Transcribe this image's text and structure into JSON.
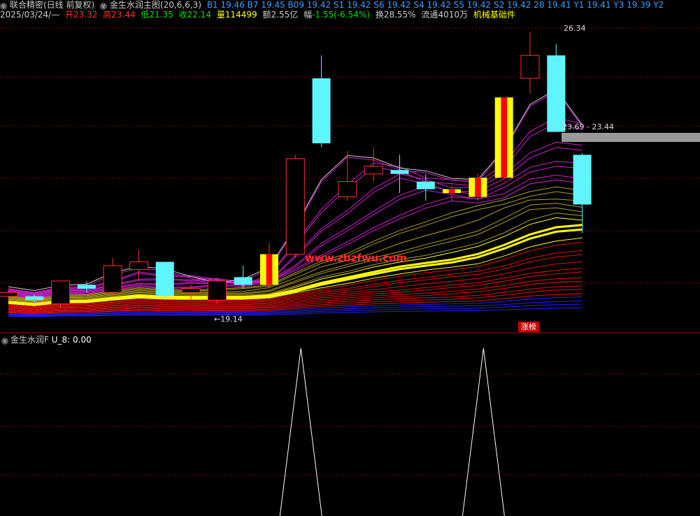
{
  "header": {
    "title": "联合精密(日线 前复权)",
    "indicator": "金生水润主图(20,6,6,3)",
    "signals": "B1 19.46 B7 19.45 B09 19.42 S1 19.42 S6 19.42 S4 19.42 S5 19.42 S2 19.42 28 19.41 Y1 19.41 Y3 19.39 Y2"
  },
  "quote": {
    "date": "2025/03/24/—",
    "open_label": "开",
    "open": "23.32",
    "high_label": "高",
    "high": "23.44",
    "low_label": "低",
    "low": "21.35",
    "close_label": "收",
    "close": "22.14",
    "volume_label": "量",
    "volume": "114499",
    "amount_label": "额",
    "amount": "2.55亿",
    "change_label": "幅",
    "change": "-1.55(-6.54%)",
    "turnover_label": "换",
    "turnover": "28.55%",
    "float_label": "流通",
    "float": "4010万",
    "sector": "机械基础件"
  },
  "labels": {
    "high_price": "26.34",
    "range": "23.69 - 23.44",
    "low_price": "←19.14",
    "watermark": "www.zbzfwu.com",
    "badge": "涨榜"
  },
  "sub": {
    "title": "金生水润F",
    "value": "U_8: 0.00"
  },
  "colors": {
    "up_candle": "#ff3030",
    "down_candle": "#5ff5ff",
    "signal": "#ffff00",
    "grid": "#8a0000"
  },
  "chart_data": {
    "type": "candlestick",
    "candles": [
      {
        "o": 19.7,
        "c": 19.8,
        "h": 19.85,
        "l": 19.6
      },
      {
        "o": 19.7,
        "c": 19.6,
        "h": 19.75,
        "l": 19.5
      },
      {
        "o": 19.5,
        "c": 20.1,
        "h": 20.1,
        "l": 19.4
      },
      {
        "o": 20.0,
        "c": 19.9,
        "h": 20.1,
        "l": 19.8
      },
      {
        "o": 19.8,
        "c": 20.5,
        "h": 20.7,
        "l": 19.7
      },
      {
        "o": 20.4,
        "c": 20.6,
        "h": 20.9,
        "l": 20.1
      },
      {
        "o": 20.6,
        "c": 19.7,
        "h": 20.6,
        "l": 19.6
      },
      {
        "o": 19.8,
        "c": 19.9,
        "h": 20.0,
        "l": 19.6
      },
      {
        "o": 19.6,
        "c": 20.1,
        "h": 20.1,
        "l": 19.5
      },
      {
        "o": 20.2,
        "c": 20.0,
        "h": 20.5,
        "l": 19.9
      },
      {
        "o": 20.0,
        "c": 20.8,
        "h": 21.1,
        "l": 19.9,
        "sig": true
      },
      {
        "o": 20.8,
        "c": 23.3,
        "h": 23.4,
        "l": 20.7
      },
      {
        "o": 25.4,
        "c": 23.7,
        "h": 26.0,
        "l": 23.6
      },
      {
        "o": 22.3,
        "c": 22.7,
        "h": 23.5,
        "l": 22.2
      },
      {
        "o": 22.9,
        "c": 23.1,
        "h": 23.6,
        "l": 22.7
      },
      {
        "o": 23.0,
        "c": 22.9,
        "h": 23.4,
        "l": 22.4
      },
      {
        "o": 22.7,
        "c": 22.5,
        "h": 22.9,
        "l": 22.2
      },
      {
        "o": 22.4,
        "c": 22.5,
        "h": 22.6,
        "l": 22.2,
        "sig": true
      },
      {
        "o": 22.3,
        "c": 22.8,
        "h": 22.9,
        "l": 22.2,
        "sig": true
      },
      {
        "o": 22.8,
        "c": 24.9,
        "h": 24.9,
        "l": 22.8,
        "sig": true
      },
      {
        "o": 25.4,
        "c": 26.0,
        "h": 26.6,
        "l": 25.0
      },
      {
        "o": 26.0,
        "c": 24.0,
        "h": 26.3,
        "l": 24.0
      },
      {
        "o": 23.4,
        "c": 22.1,
        "h": 23.44,
        "l": 21.35
      }
    ],
    "ylim": [
      19.0,
      26.9
    ],
    "sub_peaks": [
      11,
      18
    ]
  }
}
